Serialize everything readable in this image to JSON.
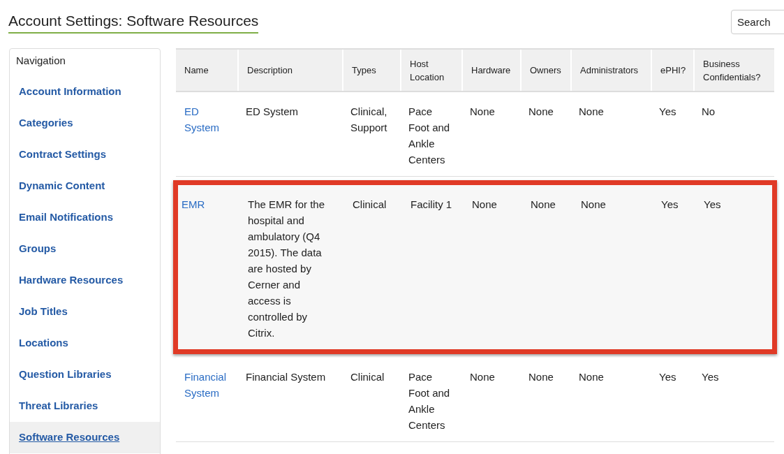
{
  "page": {
    "title": "Account Settings: Software Resources"
  },
  "search": {
    "placeholder": "Search"
  },
  "navigation": {
    "heading": "Navigation",
    "items": [
      {
        "label": "Account Information",
        "selected": false
      },
      {
        "label": "Categories",
        "selected": false
      },
      {
        "label": "Contract Settings",
        "selected": false
      },
      {
        "label": "Dynamic Content",
        "selected": false
      },
      {
        "label": "Email Notifications",
        "selected": false
      },
      {
        "label": "Groups",
        "selected": false
      },
      {
        "label": "Hardware Resources",
        "selected": false
      },
      {
        "label": "Job Titles",
        "selected": false
      },
      {
        "label": "Locations",
        "selected": false
      },
      {
        "label": "Question Libraries",
        "selected": false
      },
      {
        "label": "Threat Libraries",
        "selected": false
      },
      {
        "label": "Software Resources",
        "selected": true
      }
    ]
  },
  "table": {
    "columns": [
      "Name",
      "Description",
      "Types",
      "Host Location",
      "Hardware",
      "Owners",
      "Administrators",
      "ePHI?",
      "Business Confidentials?"
    ],
    "rows": [
      {
        "highlighted": false,
        "cells": [
          "ED System",
          "ED System",
          "Clinical, Support",
          "Pace Foot and Ankle Centers",
          "None",
          "None",
          "None",
          "Yes",
          "No"
        ]
      },
      {
        "highlighted": true,
        "cells": [
          "EMR",
          "The EMR for the hospital and ambulatory (Q4 2015). The data are hosted by Cerner and access is controlled by Citrix.",
          "Clinical",
          "Facility 1",
          "None",
          "None",
          "None",
          "Yes",
          "Yes"
        ]
      },
      {
        "highlighted": false,
        "cells": [
          "Financial System",
          "Financial System",
          "Clinical",
          "Pace Foot and Ankle Centers",
          "None",
          "None",
          "None",
          "Yes",
          "Yes"
        ]
      }
    ]
  }
}
